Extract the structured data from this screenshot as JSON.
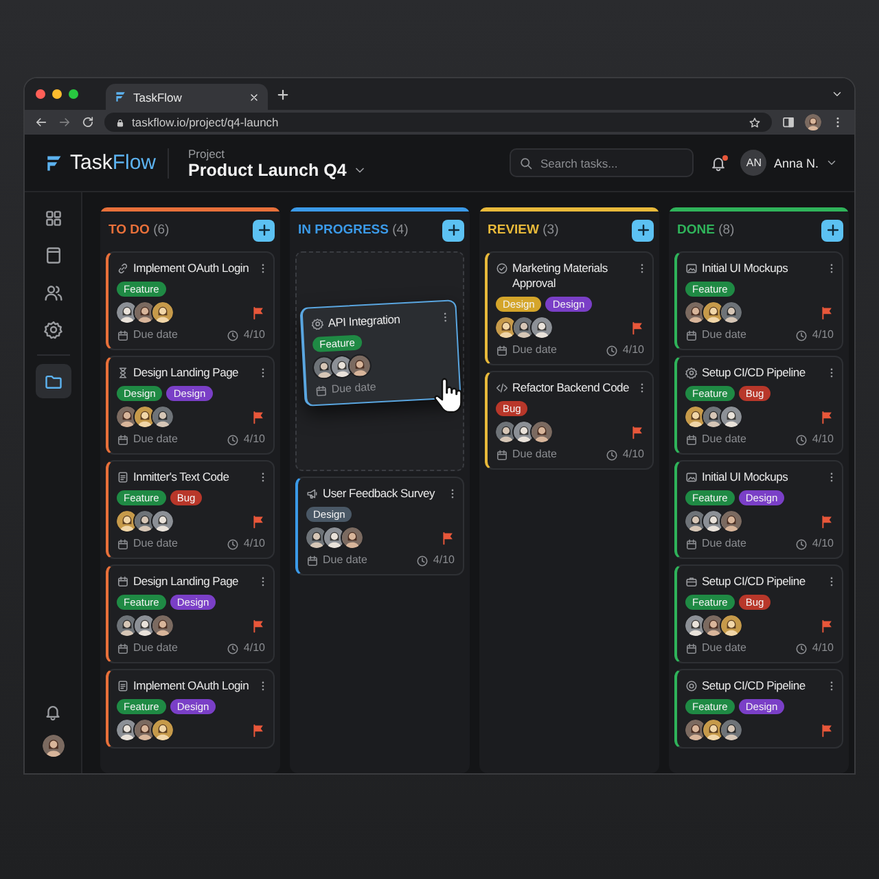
{
  "browser": {
    "tab_title": "TaskFlow",
    "url": "taskflow.io/project/q4-launch"
  },
  "header": {
    "logo": {
      "main": "Task",
      "accent": "Flow"
    },
    "project_label": "Project",
    "project_name": "Product Launch Q4",
    "search": {
      "placeholder": "Search tasks..."
    },
    "notification": true,
    "user": {
      "initials": "AN",
      "name": "Anna N."
    }
  },
  "sidebar": {
    "items": [
      {
        "selected": false
      },
      {
        "selected": false
      },
      {
        "selected": false
      },
      {
        "selected": false
      },
      {
        "selected": true
      }
    ]
  },
  "columns": [
    {
      "title": "TO DO",
      "count": "(6)",
      "color": "#e8703a",
      "drop_placeholder": false,
      "cards": [
        {
          "title": "Implement OAuth Login",
          "tags": [
            {
              "label": "Feature",
              "color": "#1f8a44"
            }
          ],
          "flagged": true,
          "due": "Due date",
          "progress": "4/10"
        },
        {
          "title": "Design Landing Page",
          "tags": [
            {
              "label": "Design",
              "color": "#1f8a44"
            },
            {
              "label": "Design",
              "color": "#7a3fc7"
            }
          ],
          "flagged": true,
          "due": "Due date",
          "progress": "4/10"
        },
        {
          "title": "Inmitter's Text Code",
          "tags": [
            {
              "label": "Feature",
              "color": "#1f8a44"
            },
            {
              "label": "Bug",
              "color": "#b8372a"
            }
          ],
          "flagged": true,
          "due": "Due date",
          "progress": "4/10"
        },
        {
          "title": "Design Landing Page",
          "tags": [
            {
              "label": "Feature",
              "color": "#1f8a44"
            },
            {
              "label": "Design",
              "color": "#7a3fc7"
            }
          ],
          "flagged": true,
          "due": "Due date",
          "progress": "4/10"
        },
        {
          "title": "Implement OAuth Login",
          "tags": [
            {
              "label": "Feature",
              "color": "#1f8a44"
            },
            {
              "label": "Design",
              "color": "#7a3fc7"
            }
          ],
          "flagged": true
        }
      ]
    },
    {
      "title": "IN PROGRESS",
      "count": "(4)",
      "color": "#3b9ae8",
      "drop_placeholder": true,
      "dragged_card": {
        "title": "API Integration",
        "tags": [
          {
            "label": "Feature",
            "color": "#1f8a44"
          }
        ],
        "due": "Due date"
      },
      "cards": [
        {
          "title": "User Feedback Survey",
          "tags": [
            {
              "label": "Design",
              "color": "#4a5866"
            }
          ],
          "flagged": true,
          "due": "Due date",
          "progress": "4/10"
        }
      ]
    },
    {
      "title": "REVIEW",
      "count": "(3)",
      "color": "#e8b93a",
      "drop_placeholder": false,
      "cards": [
        {
          "title": "Marketing Materials Approval",
          "tags": [
            {
              "label": "Design",
              "color": "#d4a52a"
            },
            {
              "label": "Design",
              "color": "#7a3fc7"
            }
          ],
          "flagged": true,
          "due": "Due date",
          "progress": "4/10"
        },
        {
          "title": "Refactor Backend Code",
          "tags": [
            {
              "label": "Bug",
              "color": "#b8372a"
            }
          ],
          "flagged": true,
          "due": "Due date",
          "progress": "4/10"
        }
      ]
    },
    {
      "title": "DONE",
      "count": "(8)",
      "color": "#2fb35a",
      "drop_placeholder": false,
      "cards": [
        {
          "title": "Initial UI Mockups",
          "tags": [
            {
              "label": "Feature",
              "color": "#1f8a44"
            }
          ],
          "flagged": true,
          "due": "Due date",
          "progress": "4/10"
        },
        {
          "title": "Setup CI/CD Pipeline",
          "tags": [
            {
              "label": "Feature",
              "color": "#1f8a44"
            },
            {
              "label": "Bug",
              "color": "#b8372a"
            }
          ],
          "flagged": true,
          "due": "Due date",
          "progress": "4/10"
        },
        {
          "title": "Initial UI Mockups",
          "tags": [
            {
              "label": "Feature",
              "color": "#1f8a44"
            },
            {
              "label": "Design",
              "color": "#7a3fc7"
            }
          ],
          "flagged": true,
          "due": "Due date",
          "progress": "4/10"
        },
        {
          "title": "Setup CI/CD Pipeline",
          "tags": [
            {
              "label": "Feature",
              "color": "#1f8a44"
            },
            {
              "label": "Bug",
              "color": "#b8372a"
            }
          ],
          "flagged": true,
          "due": "Due date",
          "progress": "4/10"
        },
        {
          "title": "Setup CI/CD Pipeline",
          "tags": [
            {
              "label": "Feature",
              "color": "#1f8a44"
            },
            {
              "label": "Design",
              "color": "#7a3fc7"
            }
          ],
          "flagged": true
        }
      ]
    }
  ]
}
